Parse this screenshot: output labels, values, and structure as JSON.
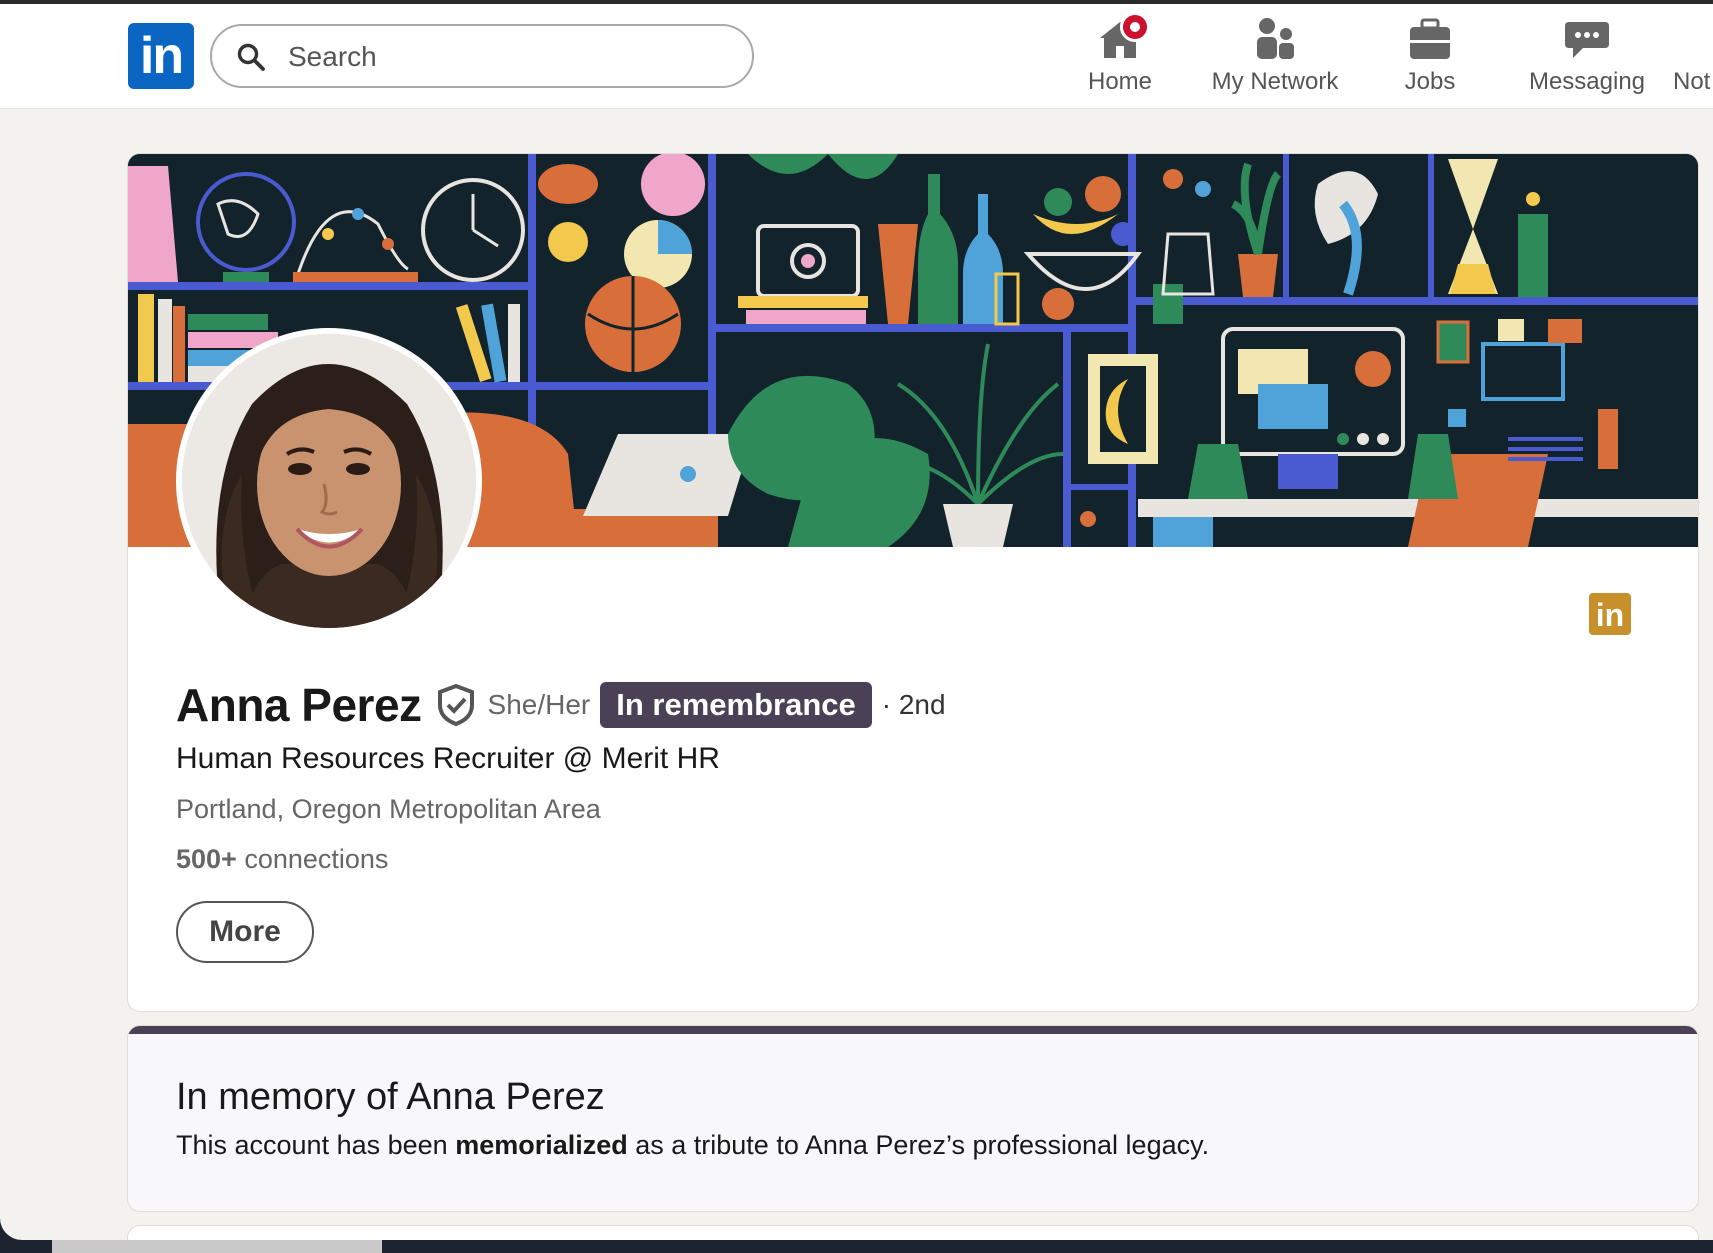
{
  "nav": {
    "logo_text": "in",
    "search_placeholder": "Search",
    "items": [
      {
        "label": "Home",
        "icon": "home-icon"
      },
      {
        "label": "My Network",
        "icon": "network-icon"
      },
      {
        "label": "Jobs",
        "icon": "briefcase-icon"
      },
      {
        "label": "Messaging",
        "icon": "messaging-icon"
      },
      {
        "label": "Not",
        "icon": "notifications-icon"
      }
    ]
  },
  "profile": {
    "name": "Anna Perez",
    "pronouns": "She/Her",
    "remembrance_badge": "In remembrance",
    "degree": "· 2nd",
    "headline": "Human Resources Recruiter @ Merit HR",
    "location": "Portland, Oregon Metropolitan Area",
    "connections_count": "500+",
    "connections_label": " connections",
    "more_label": "More",
    "badge_logo_text": "in"
  },
  "memorial": {
    "title": "In memory of Anna Perez",
    "text_before": "This account has been ",
    "text_bold": "memorialized",
    "text_after": " as a tribute to Anna Perez’s professional legacy."
  },
  "colors": {
    "linkedin_blue": "#0a66c2",
    "remembrance_purple": "#4a4157",
    "notification_red": "#cb112d",
    "page_background": "#f4f2ee",
    "premium_gold": "#c8902a"
  }
}
